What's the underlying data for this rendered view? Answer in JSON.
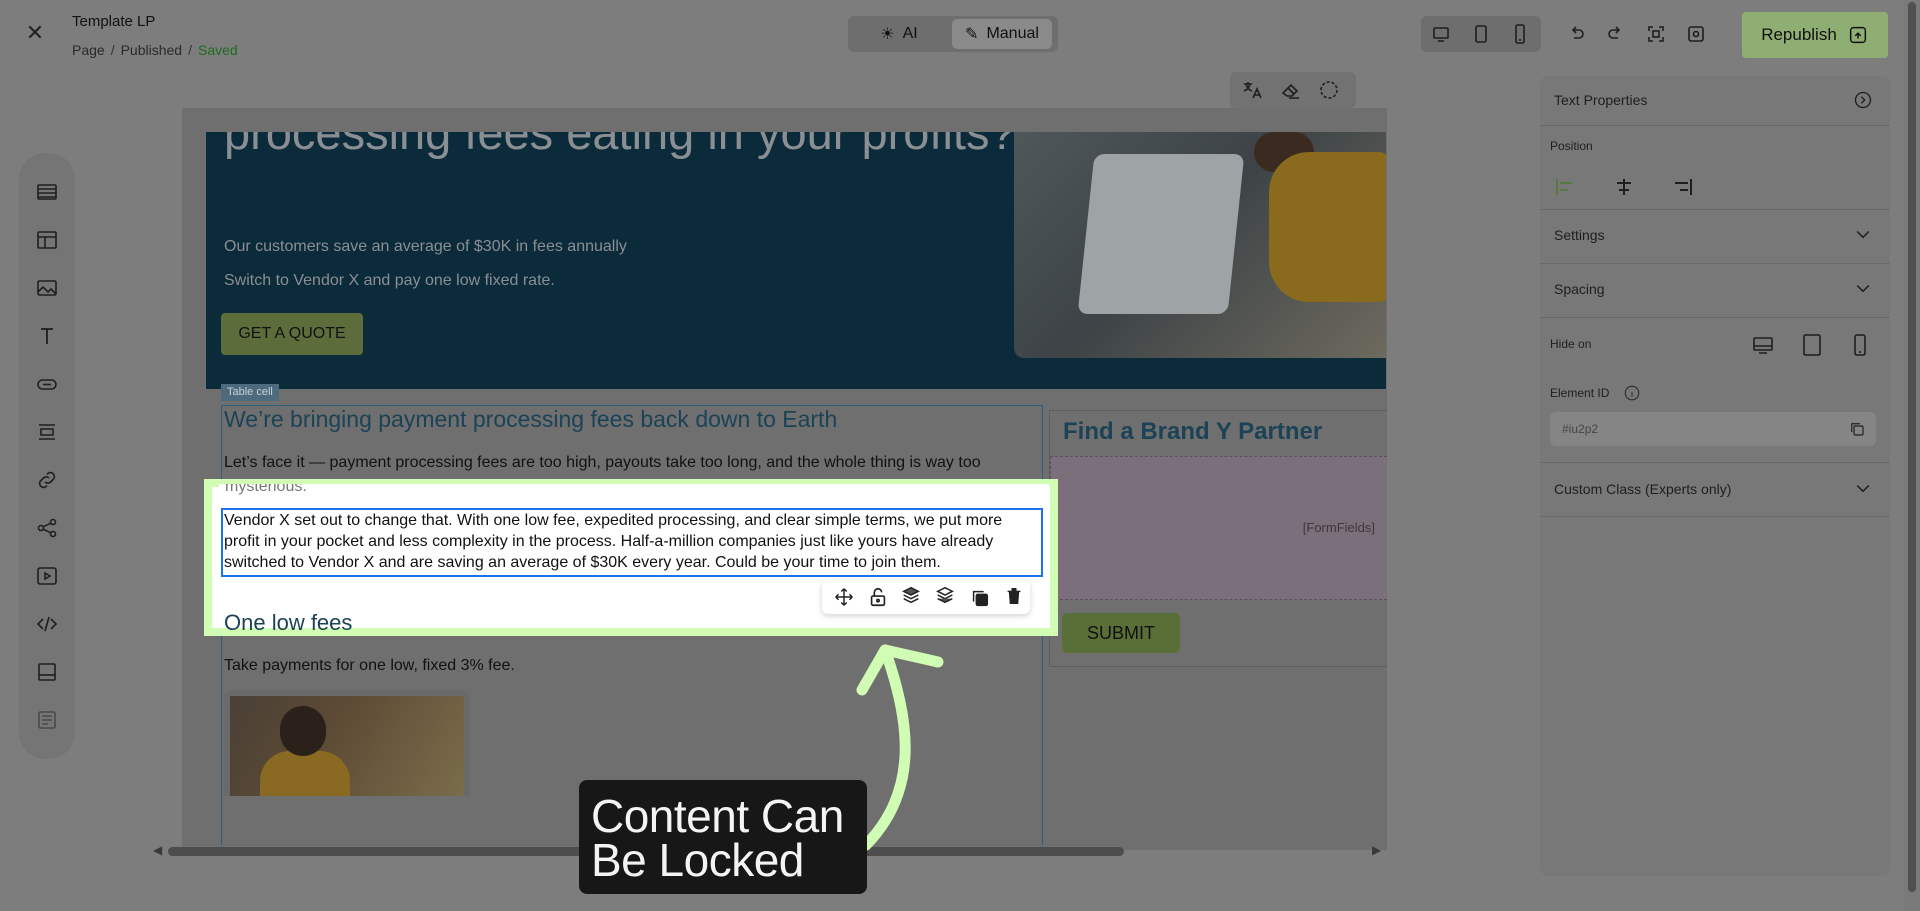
{
  "header": {
    "title": "Template LP",
    "breadcrumb": [
      "Page",
      "Published",
      "Saved"
    ],
    "mode_ai": "AI",
    "mode_manual": "Manual",
    "republish": "Republish"
  },
  "canvas": {
    "hero_heading": "processing fees eating in your profits?",
    "hero_sub1": "Our customers save an average of $30K in fees annually",
    "hero_sub2": "Switch to Vendor X and pay one low fixed rate.",
    "quote_button": "GET A QUOTE",
    "table_cell_label": "Table cell",
    "section_heading": "We’re bringing payment processing fees back down to Earth",
    "paragraph1": "Let’s face it — payment processing fees are too high, payouts take too long, and the whole thing is way too",
    "paragraph1_cont": "mysterious.",
    "selected_paragraph": "Vendor X set out to change that. With one low fee, expedited processing, and clear simple terms, we put more profit in your pocket and less complexity in the process. Half-a-million companies just like yours have already switched to Vendor X and are saving an average of $30K every year. Could be your time to join them.",
    "sub_heading": "One low fees",
    "fee_text": "Take payments for one low, fixed 3% fee.",
    "partner_title": "Find a Brand Y Partner",
    "form_fields": "[FormFields]",
    "submit": "SUBMIT"
  },
  "right_panel": {
    "title": "Text Properties",
    "position_label": "Position",
    "settings_label": "Settings",
    "spacing_label": "Spacing",
    "hide_on_label": "Hide on",
    "element_id_label": "Element ID",
    "element_id_value": "#iu2p2",
    "custom_class_label": "Custom Class (Experts only)"
  },
  "annotation": {
    "line1": "Content Can",
    "line2": "Be Locked"
  },
  "colors": {
    "highlight": "#d0fcb3",
    "selection": "#1a73e8",
    "saved": "#1d6b1d"
  }
}
